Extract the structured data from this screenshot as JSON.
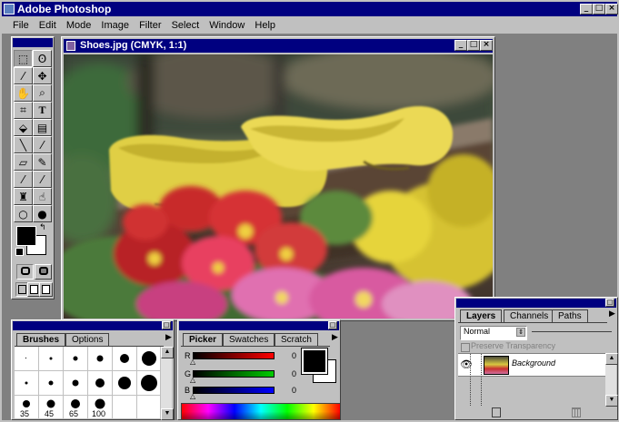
{
  "app": {
    "title": "Adobe Photoshop",
    "menu": [
      "File",
      "Edit",
      "Mode",
      "Image",
      "Filter",
      "Select",
      "Window",
      "Help"
    ]
  },
  "document": {
    "title": "Shoes.jpg  (CMYK, 1:1)"
  },
  "toolbox": {
    "tools": [
      "marquee-tool",
      "lasso-tool",
      "magic-wand-tool",
      "move-tool",
      "hand-tool",
      "zoom-tool",
      "crop-tool",
      "type-tool",
      "paint-bucket-tool",
      "gradient-tool",
      "line-tool",
      "eyedropper-tool",
      "eraser-tool",
      "pencil-tool",
      "airbrush-tool",
      "paintbrush-tool",
      "rubber-stamp-tool",
      "smudge-tool",
      "dodge-tool",
      "burn-tool"
    ]
  },
  "brushes": {
    "tabs": [
      "Brushes",
      "Options"
    ],
    "size_labels": [
      "35",
      "45",
      "65",
      "100"
    ]
  },
  "picker": {
    "tabs": [
      "Picker",
      "Swatches",
      "Scratch"
    ],
    "channels": [
      {
        "label": "R",
        "value": "0",
        "color": "#ff0000"
      },
      {
        "label": "G",
        "value": "0",
        "color": "#00cc00"
      },
      {
        "label": "B",
        "value": "0",
        "color": "#0000ff"
      }
    ]
  },
  "layers": {
    "tabs": [
      "Layers",
      "Channels",
      "Paths"
    ],
    "mode": "Normal",
    "preserve_transparency": "Preserve Transparency",
    "layer_name": "Background"
  },
  "colors": {
    "title_active": "#000080",
    "chrome": "#c0c0c0",
    "desktop": "#808080"
  }
}
